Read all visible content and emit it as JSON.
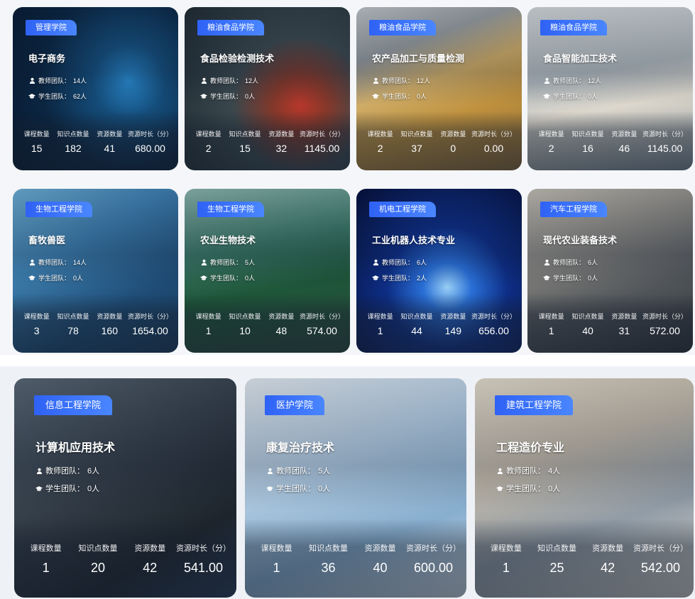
{
  "stat_labels": {
    "courses": "课程数量",
    "knowledge": "知识点数量",
    "resources": "资源数量",
    "duration": "资源时长（分）"
  },
  "meta_labels": {
    "teacher_prefix": "教师团队：",
    "student_prefix": "学生团队："
  },
  "cards": [
    {
      "college": "管理学院",
      "title": "电子商务",
      "teachers": "14人",
      "students": "62人",
      "courses": "15",
      "knowledge": "182",
      "resources": "41",
      "duration": "680.00",
      "theme": "seo"
    },
    {
      "college": "粮油食品学院",
      "title": "食品检验检测技术",
      "teachers": "12人",
      "students": "0人",
      "courses": "2",
      "knowledge": "15",
      "resources": "32",
      "duration": "1145.00",
      "theme": "lab"
    },
    {
      "college": "粮油食品学院",
      "title": "农产品加工与质量检测",
      "teachers": "12人",
      "students": "0人",
      "courses": "2",
      "knowledge": "37",
      "resources": "0",
      "duration": "0.00",
      "theme": "chips"
    },
    {
      "college": "粮油食品学院",
      "title": "食品智能加工技术",
      "teachers": "12人",
      "students": "0人",
      "courses": "2",
      "knowledge": "16",
      "resources": "46",
      "duration": "1145.00",
      "theme": "factory"
    },
    {
      "college": "生物工程学院",
      "title": "畜牧兽医",
      "teachers": "14人",
      "students": "0人",
      "courses": "3",
      "knowledge": "78",
      "resources": "160",
      "duration": "1654.00",
      "theme": "pipette"
    },
    {
      "college": "生物工程学院",
      "title": "农业生物技术",
      "teachers": "5人",
      "students": "0人",
      "courses": "1",
      "knowledge": "10",
      "resources": "48",
      "duration": "574.00",
      "theme": "plants"
    },
    {
      "college": "机电工程学院",
      "title": "工业机器人技术专业",
      "teachers": "6人",
      "students": "2人",
      "courses": "1",
      "knowledge": "44",
      "resources": "149",
      "duration": "656.00",
      "theme": "tech"
    },
    {
      "college": "汽车工程学院",
      "title": "现代农业装备技术",
      "teachers": "6人",
      "students": "0人",
      "courses": "1",
      "knowledge": "40",
      "resources": "31",
      "duration": "572.00",
      "theme": "garage"
    },
    {
      "college": "信息工程学院",
      "title": "计算机应用技术",
      "teachers": "6人",
      "students": "0人",
      "courses": "1",
      "knowledge": "20",
      "resources": "42",
      "duration": "541.00",
      "theme": "computer"
    },
    {
      "college": "医护学院",
      "title": "康复治疗技术",
      "teachers": "5人",
      "students": "0人",
      "courses": "1",
      "knowledge": "36",
      "resources": "40",
      "duration": "600.00",
      "theme": "medical"
    },
    {
      "college": "建筑工程学院",
      "title": "工程造价专业",
      "teachers": "4人",
      "students": "0人",
      "courses": "1",
      "knowledge": "25",
      "resources": "42",
      "duration": "542.00",
      "theme": "construction"
    }
  ],
  "colors": {
    "badge": "#2f62f5",
    "seo": "#0e2a4a",
    "lab": "#2c3e46",
    "chips": "#8a7a55",
    "factory": "#9aa6ad",
    "pipette": "#3b6f95",
    "plants": "#2f6a52",
    "tech": "#0a1f5a",
    "garage": "#5a5f63",
    "computer": "#3f4a56",
    "medical": "#a9c6de",
    "construction": "#b7b0a3"
  }
}
